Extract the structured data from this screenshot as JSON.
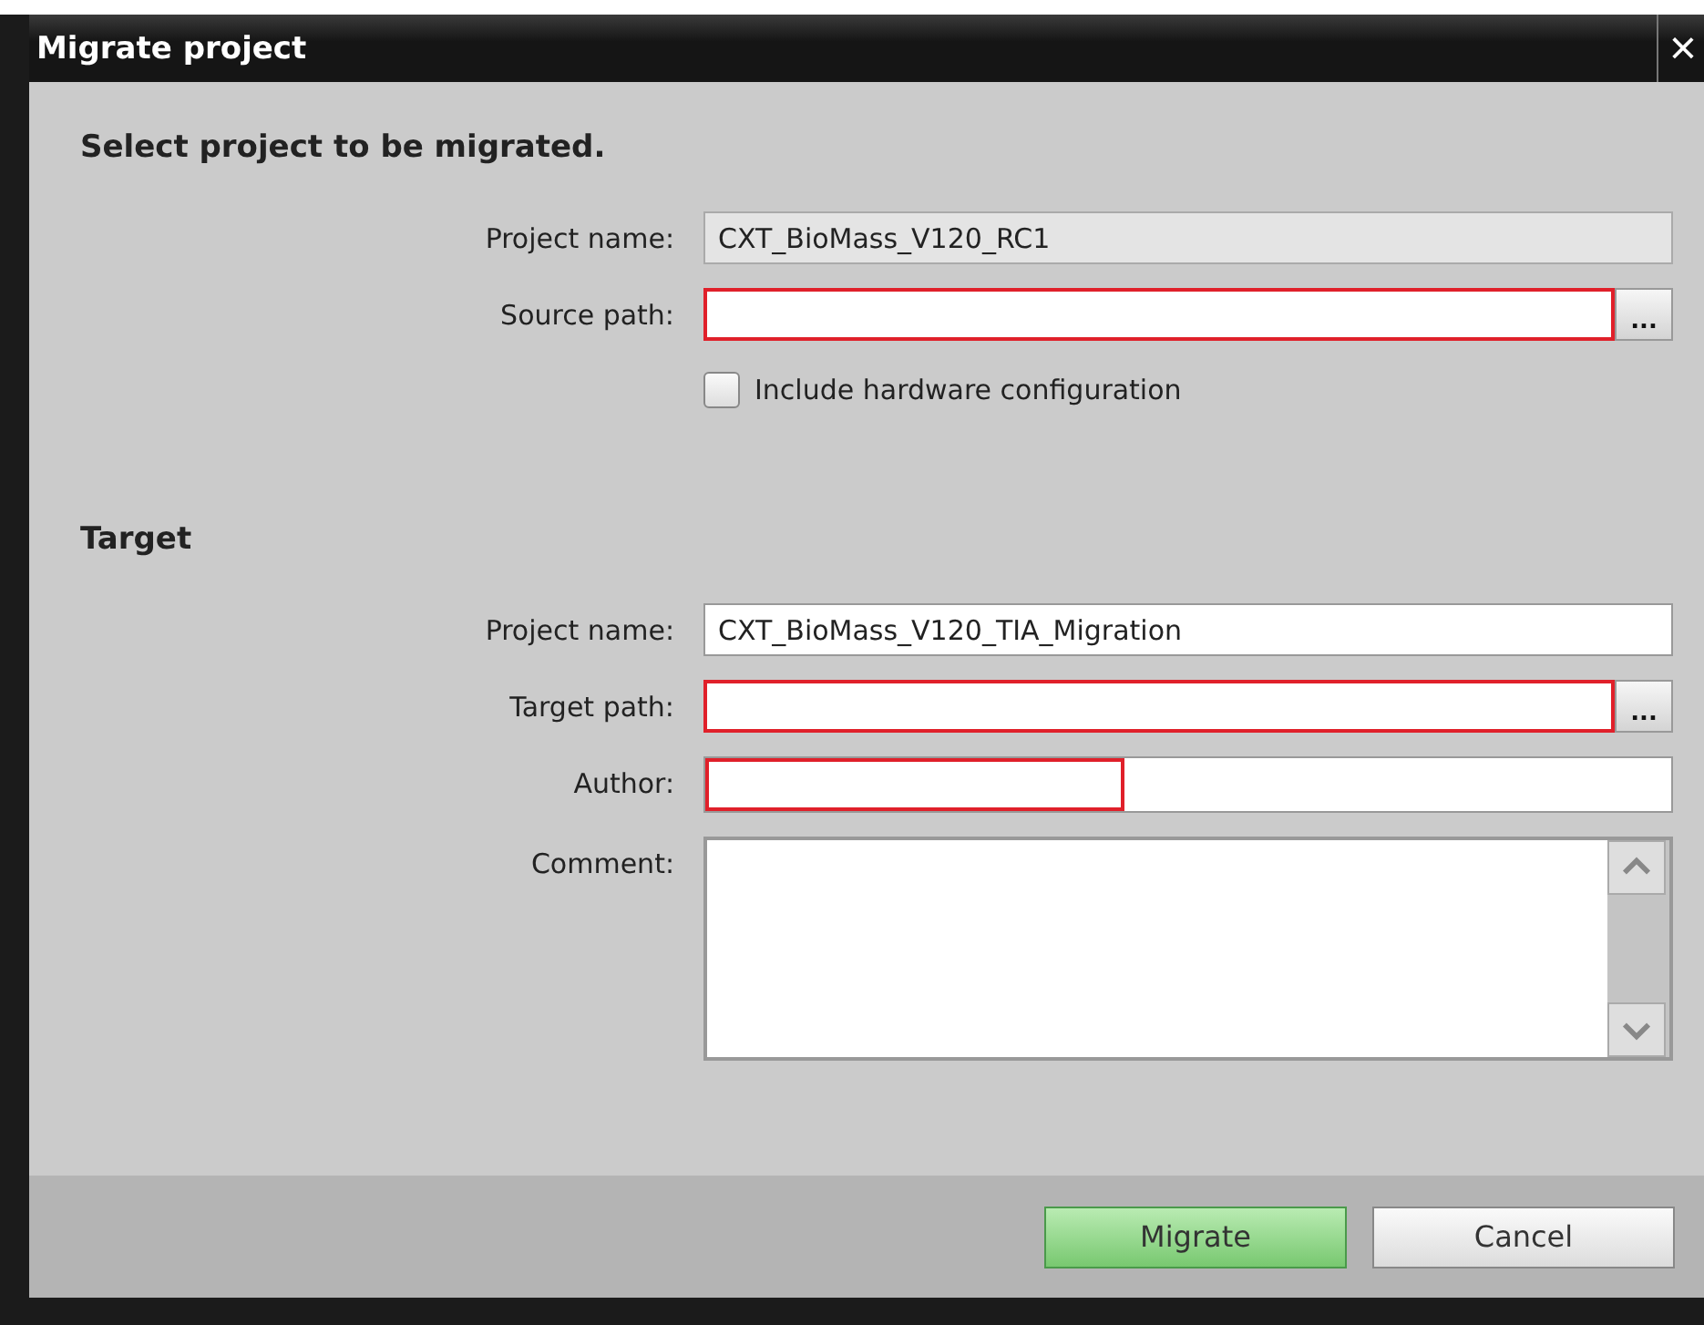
{
  "window": {
    "title": "Migrate project",
    "close": "×"
  },
  "sections": [
    {
      "heading": "Select project to be migrated.",
      "fields": [
        {
          "kind": "text",
          "label": "Project name:",
          "value": "CXT_BioMass_V120_RC1",
          "disabled": true,
          "invalid": false
        },
        {
          "kind": "path",
          "label": "Source path:",
          "disabled": false,
          "invalid": true,
          "browse": "..."
        },
        {
          "kind": "checkbox",
          "label": "Include hardware configuration",
          "checked": false
        }
      ]
    },
    {
      "heading": "Target",
      "fields": [
        {
          "kind": "text",
          "label": "Project name:",
          "value": "CXT_BioMass_V120_TIA_Migration",
          "disabled": false,
          "invalid": false
        },
        {
          "kind": "path",
          "label": "Target path:",
          "disabled": false,
          "invalid": true,
          "browse": "..."
        },
        {
          "kind": "partial",
          "label": "Author:",
          "disabled": false,
          "invalid": true
        },
        {
          "kind": "multiline",
          "label": "Comment:",
          "disabled": false,
          "invalid": false
        }
      ]
    }
  ],
  "buttons": [
    {
      "label": "Migrate",
      "primary": true
    },
    {
      "label": "Cancel",
      "primary": false
    }
  ]
}
